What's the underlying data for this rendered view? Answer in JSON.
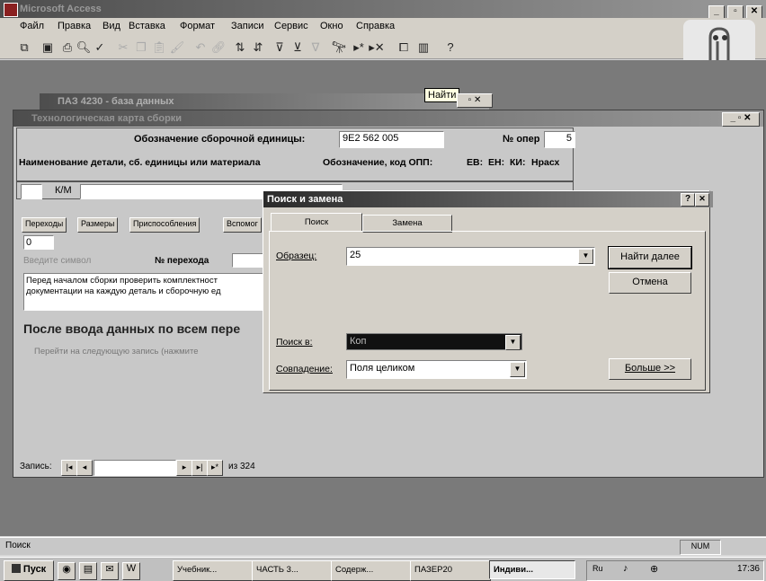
{
  "app": {
    "title": "Microsoft Access",
    "window_controls": [
      "_",
      "▫",
      "✕"
    ]
  },
  "menu": [
    "Файл",
    "Правка",
    "Вид",
    "Вставка",
    "Формат",
    "Записи",
    "Сервис",
    "Окно",
    "Справка"
  ],
  "tooltip": "Найти",
  "back_window": {
    "title": "ПАЗ 4230 - база данных"
  },
  "form": {
    "title": "Технологическая карта сборки",
    "assembly_label": "Обозначение сборочной единицы:",
    "assembly_value": "9Е2 562 005",
    "oper_label": "№ опер",
    "oper_value": "5",
    "header_name": "Наименование детали, сб. единицы или материала",
    "header_code": "Обозначение, код ОПП:",
    "header_ev": "ЕВ:",
    "header_en": "ЕН:",
    "header_ki": "КИ:",
    "header_nrash": "Нрасх",
    "km_label": "К/М",
    "tabs": [
      "Переходы",
      "Размеры",
      "Приспособления",
      "Вспомог"
    ],
    "field_value": "0",
    "hint_label": "Введите символ",
    "perehod_label": "№ перехода",
    "memo_text": "Перед началом сборки проверить комплектност документации на каждую деталь и сборочную ед",
    "big_heading": "После ввода данных по всем пере",
    "faint_line": "Перейти на следующую запись (нажмите",
    "record_label": "Запись:",
    "record_of": "из 324"
  },
  "dialog": {
    "title": "Поиск и замена",
    "tabs": [
      "Поиск",
      "Замена"
    ],
    "pattern_label": "Образец:",
    "pattern_value": "25",
    "lookin_label": "Поиск в:",
    "lookin_value": "Коп",
    "match_label": "Совпадение:",
    "match_value": "Поля целиком",
    "find_next": "Найти далее",
    "cancel": "Отмена",
    "more": "Больше >>",
    "help": "?",
    "close": "✕"
  },
  "status": {
    "text": "Поиск",
    "indicator": "NUM"
  },
  "taskbar": {
    "start": "Пуск",
    "items": [
      "Учебник...",
      "ЧАСТЬ 3...",
      "Содерж...",
      "ПАЗЕР20",
      "Индиви..."
    ],
    "time": "17:36"
  }
}
